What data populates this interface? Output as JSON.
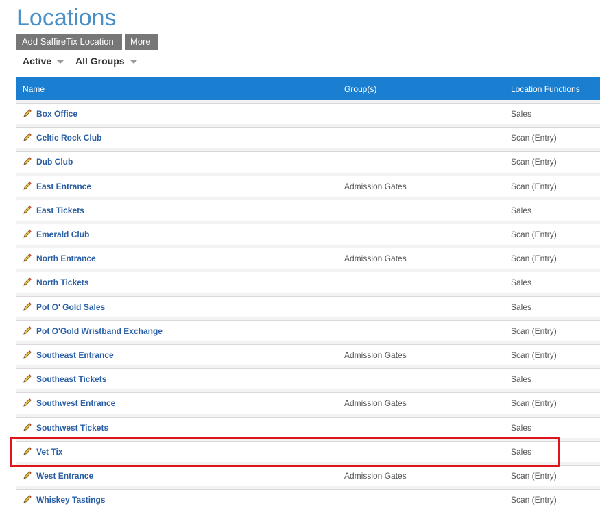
{
  "page": {
    "title": "Locations"
  },
  "toolbar": {
    "add_label": "Add SaffireTix Location",
    "more_label": "More"
  },
  "filters": {
    "status": "Active",
    "group": "All Groups"
  },
  "table": {
    "headers": {
      "name": "Name",
      "groups": "Group(s)",
      "functions": "Location Functions"
    },
    "rows": [
      {
        "name": "Box Office",
        "group": "",
        "function": "Sales"
      },
      {
        "name": "Celtic Rock Club",
        "group": "",
        "function": "Scan (Entry)"
      },
      {
        "name": "Dub Club",
        "group": "",
        "function": "Scan (Entry)"
      },
      {
        "name": "East Entrance",
        "group": "Admission Gates",
        "function": "Scan (Entry)"
      },
      {
        "name": "East Tickets",
        "group": "",
        "function": "Sales"
      },
      {
        "name": "Emerald Club",
        "group": "",
        "function": "Scan (Entry)"
      },
      {
        "name": "North Entrance",
        "group": "Admission Gates",
        "function": "Scan (Entry)"
      },
      {
        "name": "North Tickets",
        "group": "",
        "function": "Sales"
      },
      {
        "name": "Pot O' Gold Sales",
        "group": "",
        "function": "Sales"
      },
      {
        "name": "Pot O'Gold Wristband Exchange",
        "group": "",
        "function": "Scan (Entry)"
      },
      {
        "name": "Southeast Entrance",
        "group": "Admission Gates",
        "function": "Scan (Entry)"
      },
      {
        "name": "Southeast Tickets",
        "group": "",
        "function": "Sales"
      },
      {
        "name": "Southwest Entrance",
        "group": "Admission Gates",
        "function": "Scan (Entry)"
      },
      {
        "name": "Southwest Tickets",
        "group": "",
        "function": "Sales"
      },
      {
        "name": "Vet Tix",
        "group": "",
        "function": "Sales"
      },
      {
        "name": "West Entrance",
        "group": "Admission Gates",
        "function": "Scan (Entry)"
      },
      {
        "name": "Whiskey Tastings",
        "group": "",
        "function": "Scan (Entry)"
      }
    ]
  },
  "colors": {
    "header_bg": "#1a7fd0",
    "link": "#2a5fa6",
    "highlight": "#e0141b",
    "title": "#4a90c8"
  },
  "icons": {
    "edit": "pencil-icon"
  }
}
